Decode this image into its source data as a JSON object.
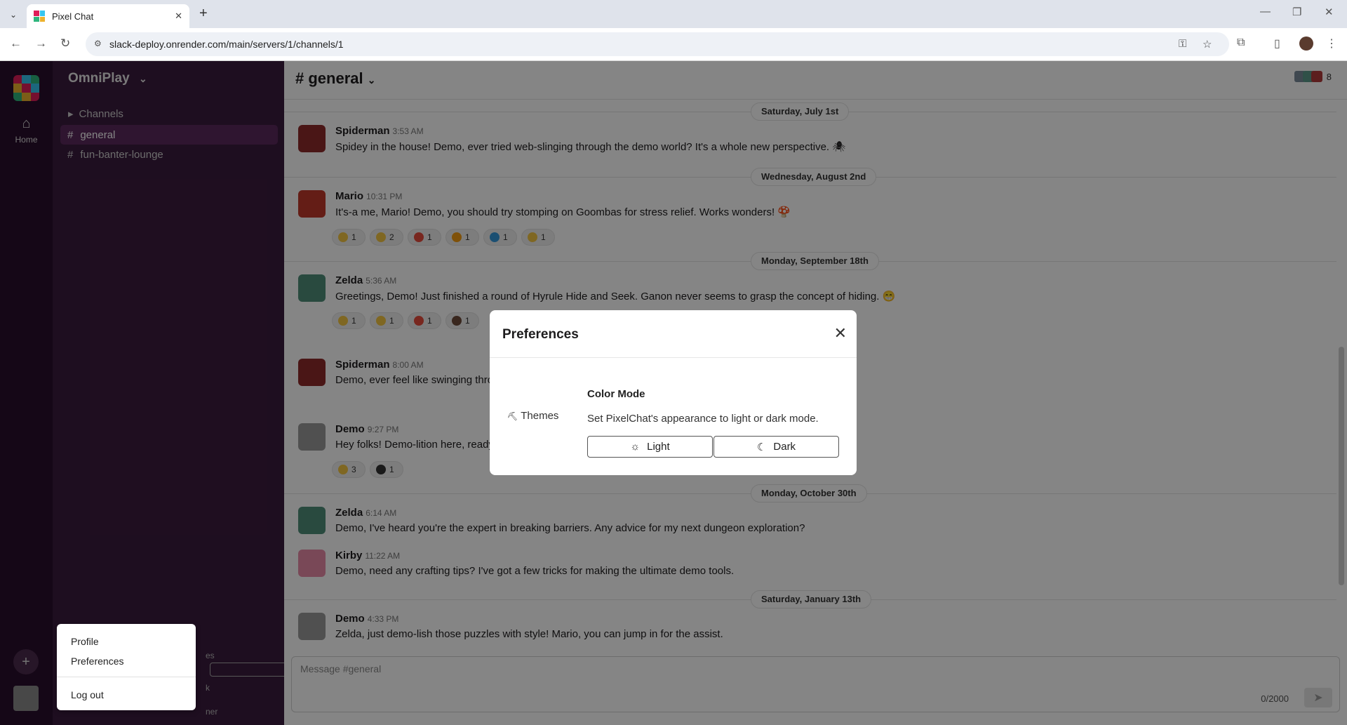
{
  "browser": {
    "tab_title": "Pixel Chat",
    "tab_close": "✕",
    "new_tab": "+",
    "url": "slack-deploy.onrender.com/main/servers/1/channels/1",
    "controls": {
      "minimize": "—",
      "restore": "❐",
      "close": "✕"
    },
    "nav": {
      "back": "←",
      "forward": "→",
      "reload": "↻"
    }
  },
  "rail": {
    "home_label": "Home",
    "add": "+"
  },
  "sidebar": {
    "server_name": "OmniPlay",
    "server_chevron": "⌄",
    "group_label": "Channels",
    "group_arrow": "▸",
    "channels": [
      {
        "label": "general",
        "active": true
      },
      {
        "label": "fun-banter-lounge",
        "active": false
      }
    ],
    "hash": "#",
    "partial": [
      "es",
      "k",
      "ner"
    ]
  },
  "channel": {
    "title": "# general",
    "chevron": "⌄",
    "member_count": "8"
  },
  "days": [
    "Saturday, July 1st",
    "Wednesday, August 2nd",
    "Monday, September 18th",
    "Monday, October 30th",
    "Saturday, January 13th"
  ],
  "messages": [
    {
      "author": "Spiderman",
      "time": "3:53 AM",
      "text": "Spidey in the house! Demo, ever tried web-slinging through the demo world? It's a whole new perspective. 🕷"
    },
    {
      "author": "Mario",
      "time": "10:31 PM",
      "text": "It's-a me, Mario! Demo, you should try stomping on Goombas for stress relief. Works wonders! 🍄"
    },
    {
      "author": "Zelda",
      "time": "5:36 AM",
      "text": "Greetings, Demo! Just finished a round of Hyrule Hide and Seek. Ganon never seems to grasp the concept of hiding. 😁"
    },
    {
      "author": "Spiderman",
      "time": "8:00 AM",
      "text": "Demo, ever feel like swinging thro"
    },
    {
      "author": "Demo",
      "time": "9:27 PM",
      "text": "Hey folks! Demo-lition here, ready"
    },
    {
      "author": "Zelda",
      "time": "6:14 AM",
      "text": "Demo, I've heard you're the expert in breaking barriers. Any advice for my next dungeon exploration?"
    },
    {
      "author": "Kirby",
      "time": "11:22 AM",
      "text": "Demo, need any crafting tips? I've got a few tricks for making the ultimate demo tools."
    },
    {
      "author": "Demo",
      "time": "4:33 PM",
      "text": "Zelda, just demo-lish those puzzles with style! Mario, you can jump in for the assist."
    }
  ],
  "reactions": {
    "mario": [
      "1",
      "2",
      "1",
      "1",
      "1",
      "1"
    ],
    "zelda": [
      "1",
      "1",
      "1",
      "1"
    ],
    "demo": [
      "3",
      "1"
    ]
  },
  "composer": {
    "placeholder": "Message #general",
    "count": "0/2000",
    "send_icon": "➤"
  },
  "user_menu": {
    "items": [
      "Profile",
      "Preferences",
      "Log out"
    ]
  },
  "modal": {
    "title": "Preferences",
    "close": "✕",
    "nav_item": "Themes",
    "nav_icon": "⛏",
    "section_title": "Color Mode",
    "section_desc": "Set PixelChat's appearance to light or dark mode.",
    "light_label": "Light",
    "dark_label": "Dark",
    "light_icon": "☼",
    "dark_icon": "☾"
  },
  "colors": {
    "rail": "#2a0e2c",
    "sidebar": "#3b1b3e",
    "active_channel": "#5a2a5d"
  }
}
